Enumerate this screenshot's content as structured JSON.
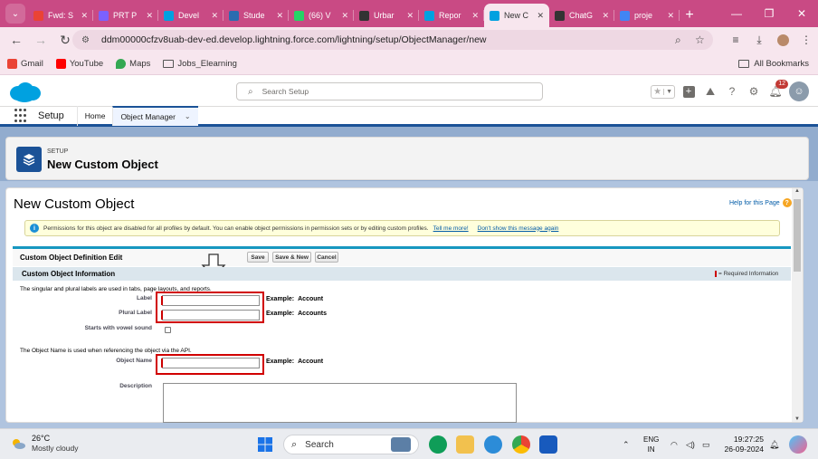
{
  "browser": {
    "tabs": [
      {
        "title": "Fwd: S",
        "color": "#ea4335",
        "active": false
      },
      {
        "title": "PRT P",
        "color": "#7b61ff",
        "active": false
      },
      {
        "title": "Devel",
        "color": "#00a1e0",
        "active": false
      },
      {
        "title": "Stude",
        "color": "#2b6cb0",
        "active": false
      },
      {
        "title": "(66) V",
        "color": "#25d366",
        "active": false
      },
      {
        "title": "Urbar",
        "color": "#333333",
        "active": false
      },
      {
        "title": "Repor",
        "color": "#00a1e0",
        "active": false
      },
      {
        "title": "New C",
        "color": "#00a1e0",
        "active": true
      },
      {
        "title": "ChatG",
        "color": "#333333",
        "active": false
      },
      {
        "title": "proje",
        "color": "#4285f4",
        "active": false
      }
    ],
    "url": "ddm00000cfzv8uab-dev-ed.develop.lightning.force.com/lightning/setup/ObjectManager/new",
    "bookmarks": [
      {
        "label": "Gmail",
        "color": "#ea4335"
      },
      {
        "label": "YouTube",
        "color": "#ff0000"
      },
      {
        "label": "Maps",
        "color": "#34a853"
      },
      {
        "label": "Jobs_Elearning",
        "color": "folder"
      }
    ],
    "all_bookmarks": "All Bookmarks"
  },
  "sf": {
    "search_placeholder": "Search Setup",
    "notification_count": "12",
    "app_name": "Setup",
    "nav": [
      {
        "label": "Home"
      },
      {
        "label": "Object Manager"
      }
    ],
    "header_eyebrow": "SETUP",
    "header_title": "New Custom Object"
  },
  "form": {
    "page_title": "New Custom Object",
    "help_link": "Help for this Page",
    "banner_text": "Permissions for this object are disabled for all profiles by default. You can enable object permissions in permission sets or by editing custom profiles.",
    "banner_link1": "Tell me more!",
    "banner_link2": "Don't show this message again",
    "block_title": "Custom Object Definition Edit",
    "buttons": {
      "save": "Save",
      "save_new": "Save & New",
      "cancel": "Cancel"
    },
    "section_title": "Custom Object Information",
    "required_legend": "= Required Information",
    "labels_desc": "The singular and plural labels are used in tabs, page layouts, and reports.",
    "label_label": "Label",
    "label_value": "",
    "label_example": "Example:",
    "label_example_value": "Account",
    "plural_label": "Plural Label",
    "plural_value": "",
    "plural_example": "Example:",
    "plural_example_value": "Accounts",
    "vowel_label": "Starts with vowel sound",
    "vowel_checked": false,
    "name_desc": "The Object Name is used when referencing the object via the API.",
    "name_label": "Object Name",
    "name_value": "",
    "name_example": "Example:",
    "name_example_value": "Account",
    "description_label": "Description"
  },
  "taskbar": {
    "temperature": "26°C",
    "weather": "Mostly cloudy",
    "search": "Search",
    "lang1": "ENG",
    "lang2": "IN",
    "time": "19:27:25",
    "date": "26-09-2024"
  }
}
